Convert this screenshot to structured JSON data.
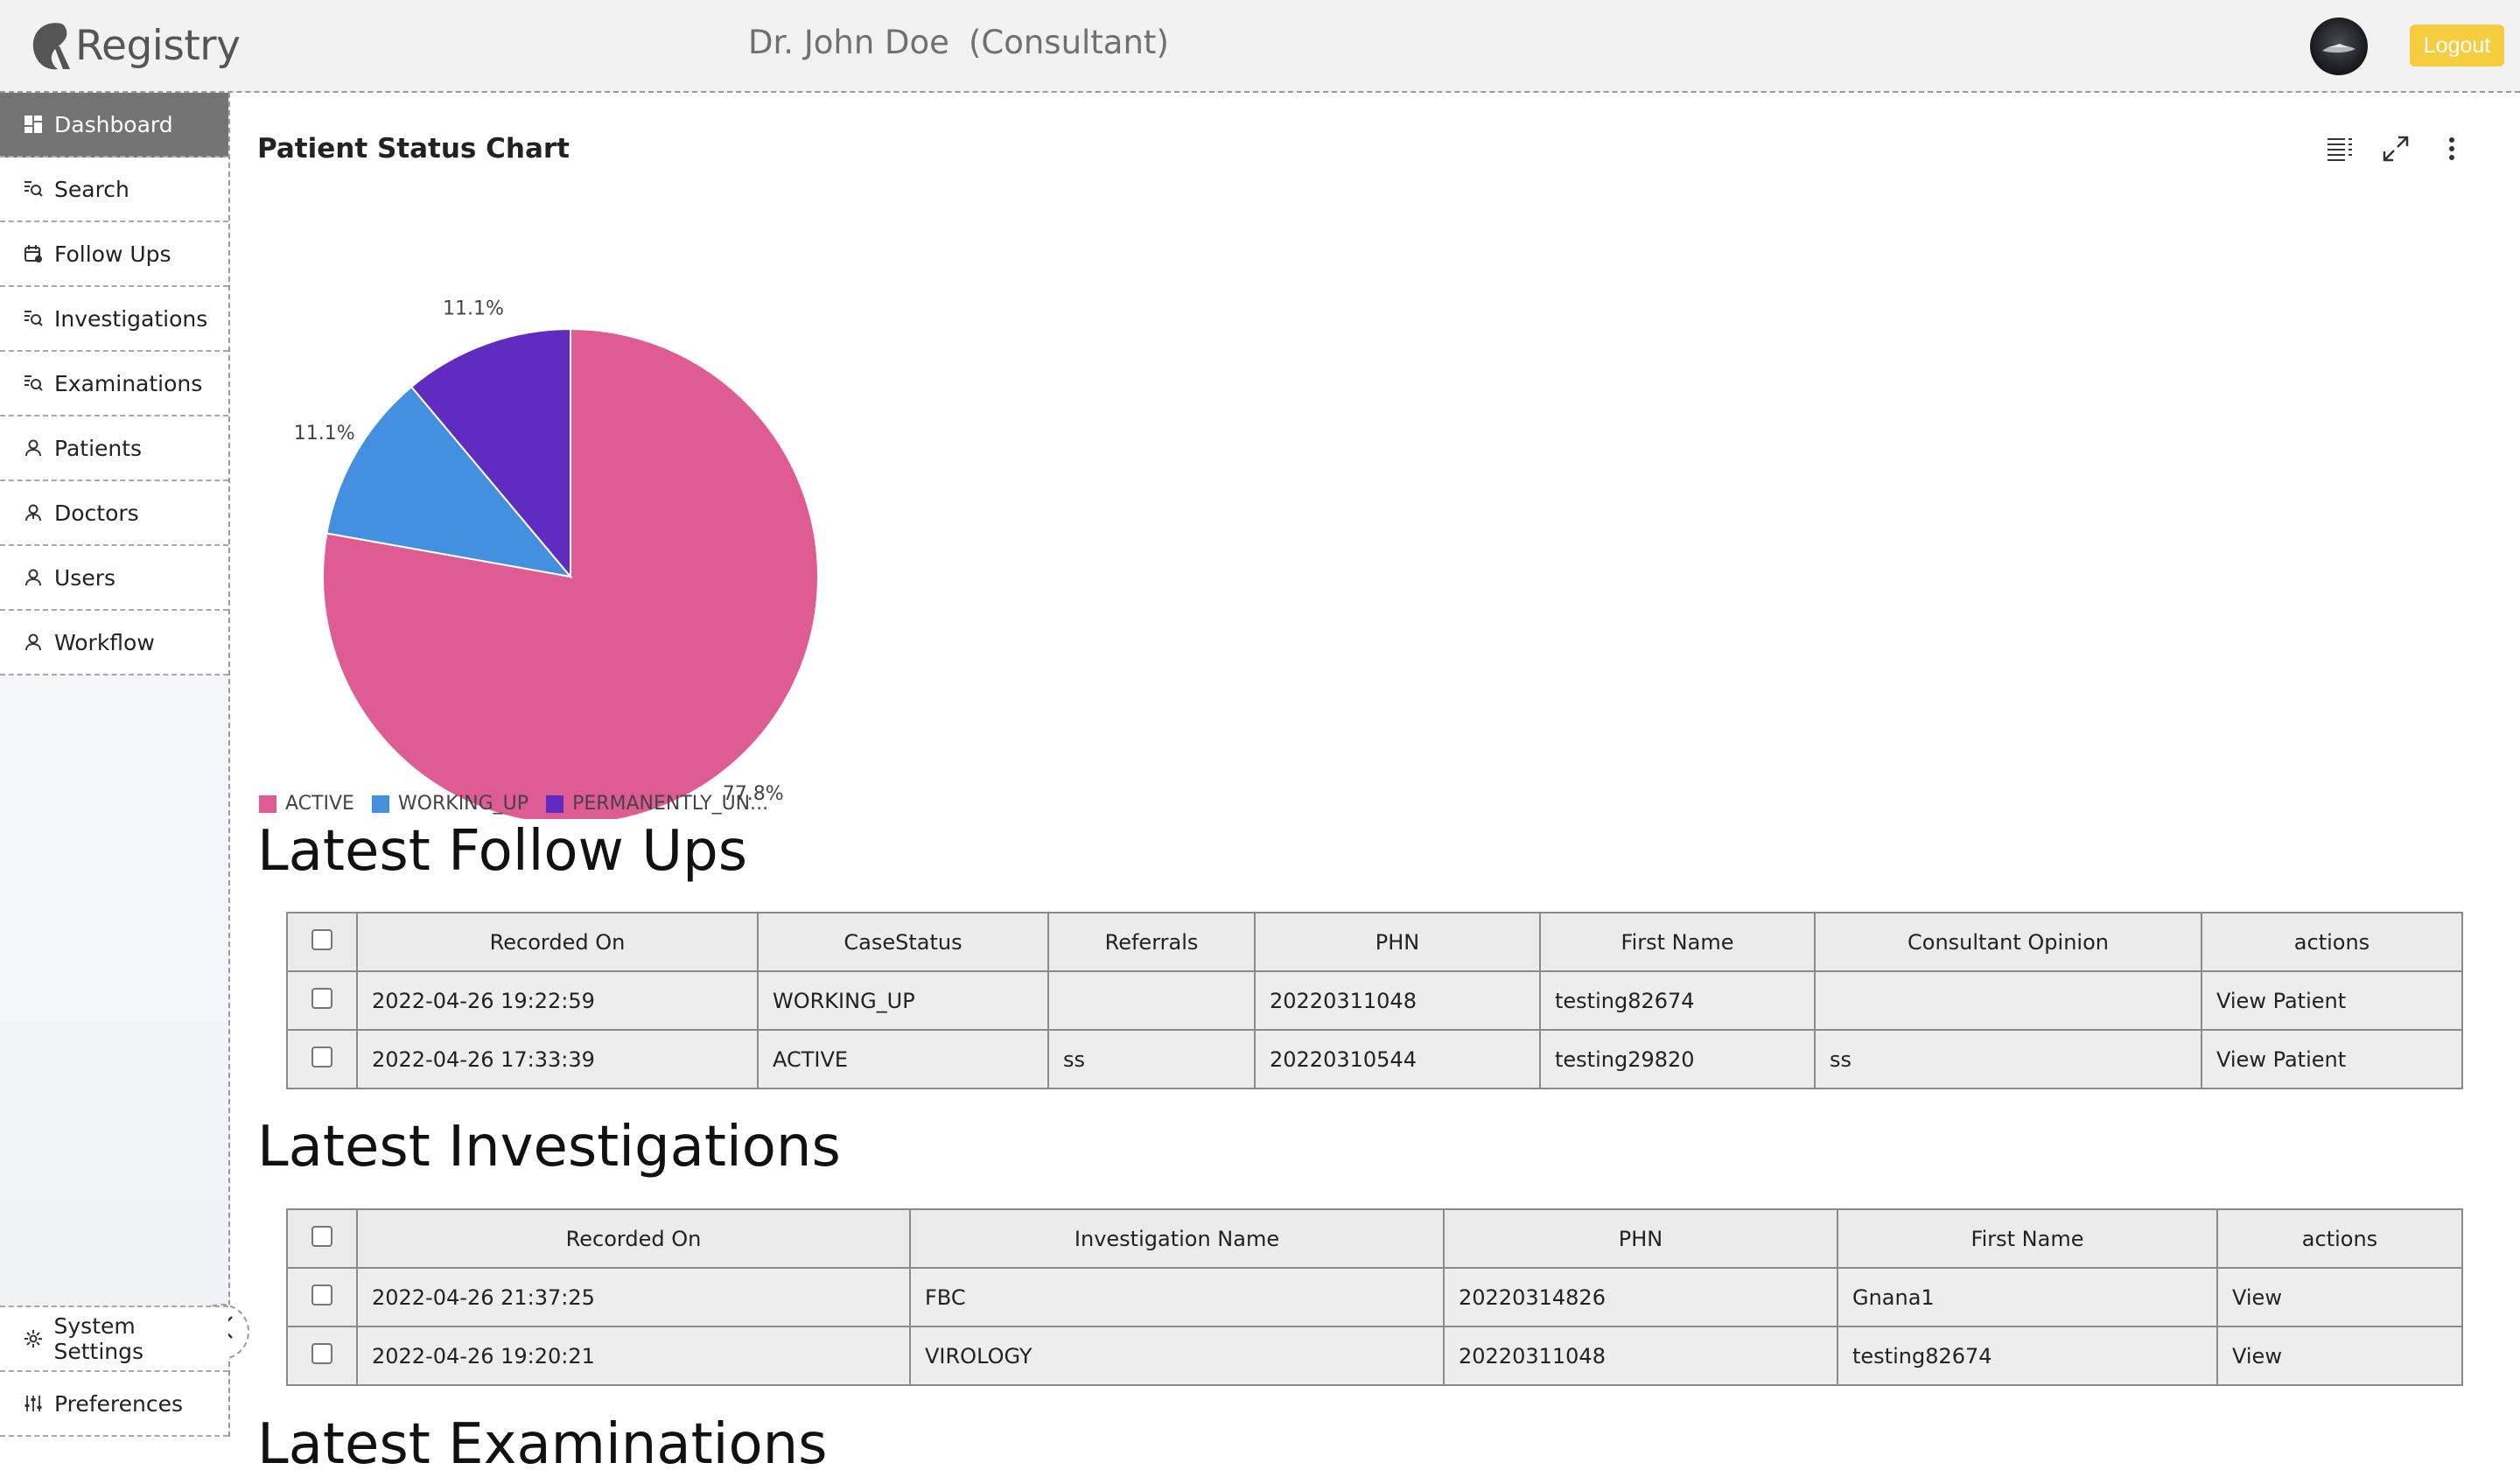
{
  "header": {
    "app_name": "Registry",
    "doctor_name": "Dr. John Doe",
    "doctor_role": "(Consultant)",
    "logout_label": "Logout"
  },
  "sidebar": {
    "items": [
      {
        "label": "Dashboard",
        "icon": "dashboard-icon",
        "active": true
      },
      {
        "label": "Search",
        "icon": "search-list-icon"
      },
      {
        "label": "Follow Ups",
        "icon": "calendar-icon"
      },
      {
        "label": "Investigations",
        "icon": "search-list-icon"
      },
      {
        "label": "Examinations",
        "icon": "search-list-icon"
      },
      {
        "label": "Patients",
        "icon": "user-icon"
      },
      {
        "label": "Doctors",
        "icon": "doctor-icon"
      },
      {
        "label": "Users",
        "icon": "user-icon"
      },
      {
        "label": "Workflow",
        "icon": "user-icon"
      }
    ],
    "bottom_items": [
      {
        "label": "System Settings",
        "icon": "gear-icon"
      },
      {
        "label": "Preferences",
        "icon": "sliders-icon"
      }
    ],
    "collapse_icon": "double-chevron-left-icon"
  },
  "chart": {
    "title": "Patient Status Chart",
    "tools": [
      "menu-list-icon",
      "expand-icon",
      "more-vertical-icon"
    ]
  },
  "chart_data": {
    "type": "pie",
    "title": "Patient Status Chart",
    "categories": [
      "ACTIVE",
      "WORKING_UP",
      "PERMANENTLY_UN..."
    ],
    "values": [
      77.8,
      11.1,
      11.1
    ],
    "labels": [
      "77.8%",
      "11.1%",
      "11.1%"
    ],
    "colors": [
      "#de5c93",
      "#4390e0",
      "#602bc0"
    ],
    "legend": "bottom-left"
  },
  "followups": {
    "title": "Latest Follow Ups",
    "columns": [
      "Recorded On",
      "CaseStatus",
      "Referrals",
      "PHN",
      "First Name",
      "Consultant Opinion",
      "actions"
    ],
    "rows": [
      [
        "2022-04-26 19:22:59",
        "WORKING_UP",
        "",
        "20220311048",
        "testing82674",
        "",
        "View Patient"
      ],
      [
        "2022-04-26 17:33:39",
        "ACTIVE",
        "ss",
        "20220310544",
        "testing29820",
        "ss",
        "View Patient"
      ]
    ]
  },
  "investigations": {
    "title": "Latest Investigations",
    "columns": [
      "Recorded On",
      "Investigation Name",
      "PHN",
      "First Name",
      "actions"
    ],
    "rows": [
      [
        "2022-04-26 21:37:25",
        "FBC",
        "20220314826",
        "Gnana1",
        "View"
      ],
      [
        "2022-04-26 19:20:21",
        "VIROLOGY",
        "20220311048",
        "testing82674",
        "View"
      ]
    ]
  },
  "examinations": {
    "title": "Latest Examinations"
  }
}
